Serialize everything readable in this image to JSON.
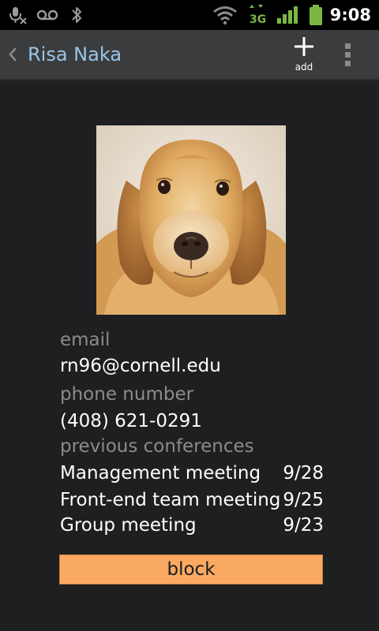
{
  "status_bar": {
    "time": "9:08",
    "network_label": "3G",
    "icons": [
      "mic-muted-icon",
      "voicemail-icon",
      "bluetooth-icon",
      "wifi-icon",
      "3g-data-icon",
      "signal-icon",
      "battery-icon"
    ],
    "accent_color": "#7ab843"
  },
  "action_bar": {
    "title": "Risa Naka",
    "add_label": "add",
    "title_color": "#9ac4e8"
  },
  "contact": {
    "photo_icon": "dog-photo",
    "email_label": "email",
    "email": "rn96@cornell.edu",
    "phone_label": "phone number",
    "phone": "(408) 621-0291",
    "conferences_label": "previous conferences",
    "conferences": [
      {
        "name": "Management meeting",
        "date": "9/28"
      },
      {
        "name": "Front-end team meeting",
        "date": "9/25"
      },
      {
        "name": "Group meeting",
        "date": "9/23"
      }
    ]
  },
  "block_button": {
    "label": "block",
    "color": "#f9a961"
  }
}
